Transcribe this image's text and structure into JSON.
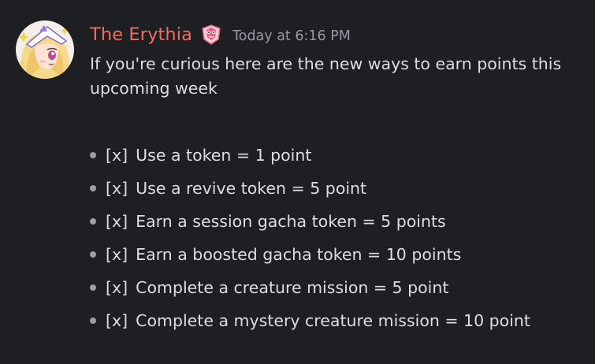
{
  "message": {
    "username": "The Erythia",
    "username_color": "#ee6e64",
    "role_icon": "pink-gem-badge-icon",
    "timestamp": "Today at 6:16 PM",
    "text": "If you're curious here are the new ways to earn points this upcoming week",
    "avatar": "anime-character-avatar",
    "items": [
      {
        "marker": "[x]",
        "label": "Use a token = 1 point"
      },
      {
        "marker": "[x]",
        "label": "Use a revive token = 5 point"
      },
      {
        "marker": "[x]",
        "label": "Earn a session gacha token = 5 points"
      },
      {
        "marker": "[x]",
        "label": "Earn a boosted gacha token = 10 points"
      },
      {
        "marker": "[x]",
        "label": "Complete a creature mission = 5 point"
      },
      {
        "marker": "[x]",
        "label": "Complete a mystery creature mission = 10 point"
      }
    ]
  },
  "colors": {
    "background": "#1e1f22",
    "text": "#dbdee1",
    "muted": "#949ba4"
  }
}
